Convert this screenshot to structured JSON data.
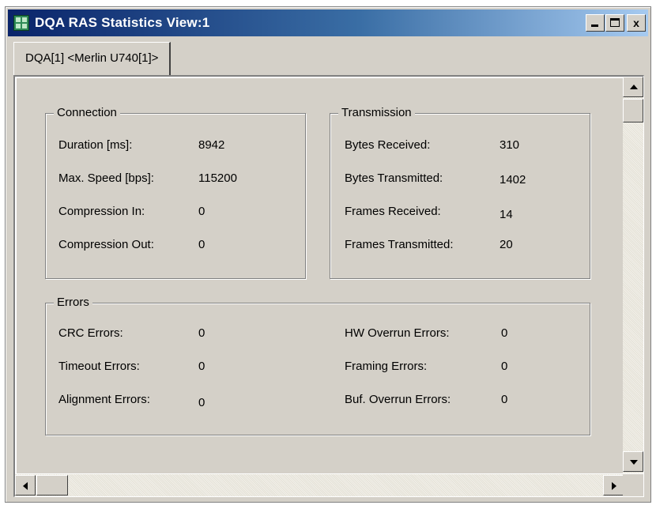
{
  "window": {
    "title": "DQA RAS Statistics View:1",
    "icon": "grid-app-icon",
    "controls": {
      "minimize": "_",
      "maximize": "□",
      "close": "x"
    }
  },
  "tabs": [
    {
      "label": "DQA[1] <Merlin U740[1]>",
      "active": true
    }
  ],
  "connection": {
    "title": "Connection",
    "rows": [
      {
        "label": "Duration [ms]:",
        "value": "8942"
      },
      {
        "label": "Max. Speed [bps]:",
        "value": "115200"
      },
      {
        "label": "Compression In:",
        "value": "0"
      },
      {
        "label": "Compression Out:",
        "value": "0"
      }
    ]
  },
  "transmission": {
    "title": "Transmission",
    "rows": [
      {
        "label": "Bytes Received:",
        "value": "310"
      },
      {
        "label": "Bytes Transmitted:",
        "value": "1402"
      },
      {
        "label": "Frames Received:",
        "value": "14"
      },
      {
        "label": "Frames Transmitted:",
        "value": "20"
      }
    ]
  },
  "errors": {
    "title": "Errors",
    "left_rows": [
      {
        "label": "CRC Errors:",
        "value": "0"
      },
      {
        "label": "Timeout Errors:",
        "value": "0"
      },
      {
        "label": "Alignment Errors:",
        "value": "0"
      }
    ],
    "right_rows": [
      {
        "label": "HW Overrun Errors:",
        "value": "0"
      },
      {
        "label": "Framing Errors:",
        "value": "0"
      },
      {
        "label": "Buf. Overrun Errors:",
        "value": "0"
      }
    ]
  },
  "colors": {
    "titlebar_start": "#0a246a",
    "titlebar_end": "#a6caf0",
    "face": "#d4d0c8"
  }
}
